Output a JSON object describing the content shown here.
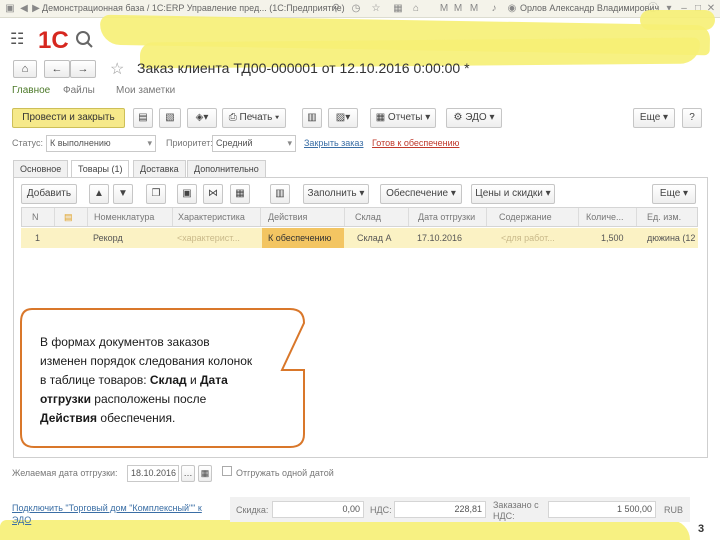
{
  "window": {
    "title": "Демонстрационная база / 1С:ERP Управление пред... (1С:Предприятие)",
    "user": "Орлов Александр Владимирович"
  },
  "app": {
    "logo_text": "1С"
  },
  "document": {
    "title": "Заказ клиента ТД00-000001 от 12.10.2016 0:00:00 *",
    "nav_links": [
      "Главное",
      "Файлы",
      "Мои заметки"
    ]
  },
  "toolbar": {
    "post_close": "Провести и закрыть",
    "print": "Печать",
    "reports": "Отчеты",
    "edo": "ЭДО",
    "more": "Еще",
    "help": "?"
  },
  "status_row": {
    "status_label": "Статус:",
    "status_value": "К выполнению",
    "priority_label": "Приоритет:",
    "priority_value": "Средний",
    "close_order_link": "Закрыть заказ",
    "ready_link": "Готов к обеспечению"
  },
  "tabs": [
    "Основное",
    "Товары (1)",
    "Доставка",
    "Дополнительно"
  ],
  "table_toolbar": {
    "add": "Добавить",
    "fill": "Заполнить",
    "supply": "Обеспечение",
    "prices": "Цены и скидки",
    "more": "Еще"
  },
  "table": {
    "columns": [
      "N",
      "Номенклатура",
      "Характеристика",
      "Действия",
      "Склад",
      "Дата отгрузки",
      "Содержание",
      "Количе...",
      "Ед. изм."
    ],
    "rows": [
      {
        "n": "1",
        "item": "Рекорд",
        "characteristic": "<характерист...",
        "action": "К обеспечению",
        "warehouse": "Склад А",
        "ship_date": "17.10.2016",
        "content": "<для работ...",
        "qty": "1,500",
        "unit": "дюжина (12"
      }
    ]
  },
  "callout": {
    "line1": "В формах документов заказов",
    "line2": "изменен порядок следования колонок",
    "line3_pre": "в таблице товаров: ",
    "bold1": "Склад",
    "and": " и ",
    "bold2": "Дата",
    "bold3": "отгрузки",
    "line4_post": " расположены после",
    "bold4": "Действия",
    "line5_post": " обеспечения."
  },
  "shipping": {
    "label": "Желаемая дата отгрузки:",
    "date": "18.10.2016",
    "one_date_label": "Отгружать одной датой"
  },
  "footer": {
    "connect_link_line1": "Подключить \"Торговый дом \"Комплексный\"\" к",
    "connect_link_line2": "ЭДО",
    "discount_label": "Скидка:",
    "discount_value": "0,00",
    "vat_label": "НДС:",
    "vat_value": "228,81",
    "ordered_label_line1": "Заказано с",
    "ordered_label_line2": "НДС:",
    "ordered_value": "1 500,00",
    "currency": "RUB"
  },
  "page_number": "3",
  "colors": {
    "accent_green": "#4d7a2a",
    "highlight_yellow": "#f6ef74",
    "primary_button": "#f6e98a",
    "row_selected": "#fbf2c4",
    "active_cell": "#f3c562",
    "callout_border": "#d9772a",
    "logo_red": "#d6271f"
  }
}
